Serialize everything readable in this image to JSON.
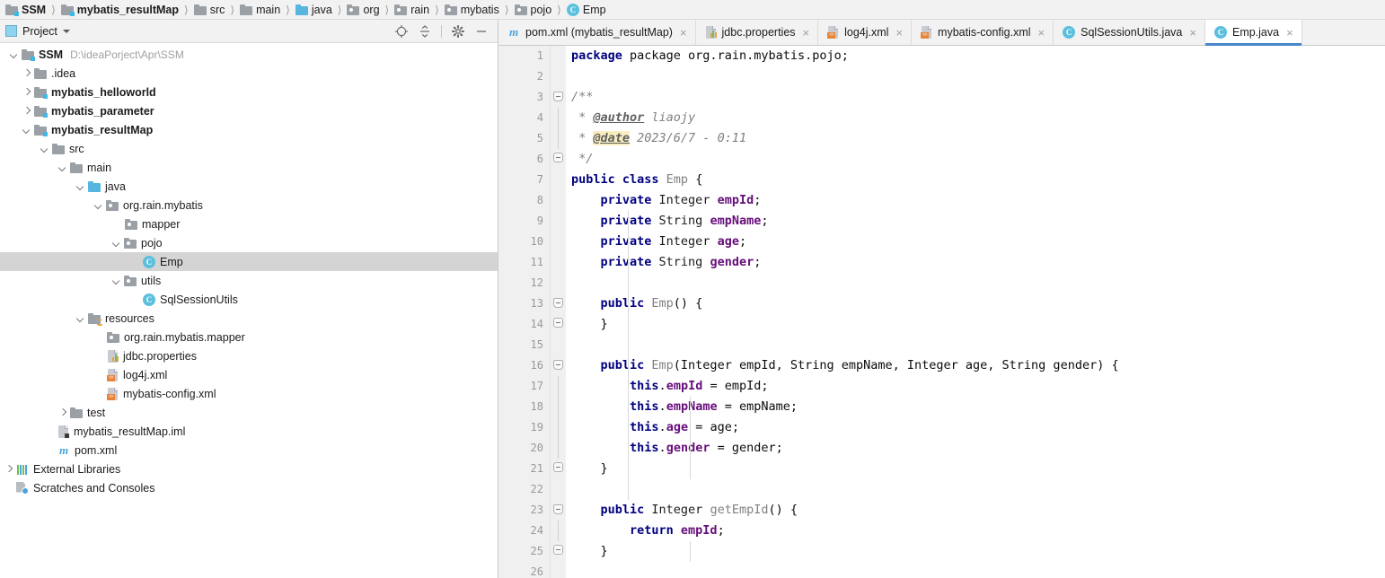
{
  "breadcrumb": [
    {
      "label": "SSM",
      "icon": "module-icon",
      "bold": true
    },
    {
      "label": "mybatis_resultMap",
      "icon": "module-icon",
      "bold": true
    },
    {
      "label": "src",
      "icon": "folder-icon",
      "bold": false
    },
    {
      "label": "main",
      "icon": "folder-icon",
      "bold": false
    },
    {
      "label": "java",
      "icon": "source-folder-icon",
      "bold": false
    },
    {
      "label": "org",
      "icon": "package-icon",
      "bold": false
    },
    {
      "label": "rain",
      "icon": "package-icon",
      "bold": false
    },
    {
      "label": "mybatis",
      "icon": "package-icon",
      "bold": false
    },
    {
      "label": "pojo",
      "icon": "package-icon",
      "bold": false
    },
    {
      "label": "Emp",
      "icon": "class-icon",
      "bold": false
    }
  ],
  "project_panel": {
    "title": "Project",
    "tools": [
      {
        "name": "locate-icon"
      },
      {
        "name": "collapse-all-icon"
      },
      {
        "name": "settings-gear-icon"
      },
      {
        "name": "hide-panel-icon"
      }
    ],
    "tree": [
      {
        "label": "SSM",
        "path": "D:\\ideaPorject\\Apr\\SSM",
        "icon": "module-icon",
        "arrow": "down",
        "indent": 0,
        "bold": true,
        "selected": false
      },
      {
        "label": ".idea",
        "path": "",
        "icon": "folder-icon",
        "arrow": "right",
        "indent": 1,
        "bold": false,
        "selected": false
      },
      {
        "label": "mybatis_helloworld",
        "path": "",
        "icon": "module-icon",
        "arrow": "right",
        "indent": 1,
        "bold": true,
        "selected": false
      },
      {
        "label": "mybatis_parameter",
        "path": "",
        "icon": "module-icon",
        "arrow": "right",
        "indent": 1,
        "bold": true,
        "selected": false
      },
      {
        "label": "mybatis_resultMap",
        "path": "",
        "icon": "module-icon",
        "arrow": "down",
        "indent": 1,
        "bold": true,
        "selected": false
      },
      {
        "label": "src",
        "path": "",
        "icon": "folder-icon",
        "arrow": "down",
        "indent": 2,
        "bold": false,
        "selected": false
      },
      {
        "label": "main",
        "path": "",
        "icon": "folder-icon",
        "arrow": "down",
        "indent": 3,
        "bold": false,
        "selected": false
      },
      {
        "label": "java",
        "path": "",
        "icon": "source-folder-icon",
        "arrow": "down",
        "indent": 4,
        "bold": false,
        "selected": false
      },
      {
        "label": "org.rain.mybatis",
        "path": "",
        "icon": "package-icon",
        "arrow": "down",
        "indent": 5,
        "bold": false,
        "selected": false
      },
      {
        "label": "mapper",
        "path": "",
        "icon": "package-icon",
        "arrow": "none",
        "indent": 6,
        "bold": false,
        "selected": false
      },
      {
        "label": "pojo",
        "path": "",
        "icon": "package-icon",
        "arrow": "down",
        "indent": 6,
        "bold": false,
        "selected": false
      },
      {
        "label": "Emp",
        "path": "",
        "icon": "class-icon",
        "arrow": "none",
        "indent": 7,
        "bold": false,
        "selected": true
      },
      {
        "label": "utils",
        "path": "",
        "icon": "package-icon",
        "arrow": "down",
        "indent": 6,
        "bold": false,
        "selected": false
      },
      {
        "label": "SqlSessionUtils",
        "path": "",
        "icon": "class-icon",
        "arrow": "none",
        "indent": 7,
        "bold": false,
        "selected": false
      },
      {
        "label": "resources",
        "path": "",
        "icon": "resources-folder-icon",
        "arrow": "down",
        "indent": 4,
        "bold": false,
        "selected": false
      },
      {
        "label": "org.rain.mybatis.mapper",
        "path": "",
        "icon": "package-icon",
        "arrow": "none",
        "indent": 5,
        "bold": false,
        "selected": false
      },
      {
        "label": "jdbc.properties",
        "path": "",
        "icon": "properties-file-icon",
        "arrow": "none",
        "indent": 5,
        "bold": false,
        "selected": false
      },
      {
        "label": "log4j.xml",
        "path": "",
        "icon": "xml-file-icon",
        "arrow": "none",
        "indent": 5,
        "bold": false,
        "selected": false
      },
      {
        "label": "mybatis-config.xml",
        "path": "",
        "icon": "xml-file-icon",
        "arrow": "none",
        "indent": 5,
        "bold": false,
        "selected": false
      },
      {
        "label": "test",
        "path": "",
        "icon": "folder-icon",
        "arrow": "right",
        "indent": 3,
        "bold": false,
        "selected": false
      },
      {
        "label": "mybatis_resultMap.iml",
        "path": "",
        "icon": "iml-file-icon",
        "arrow": "none",
        "indent": 3,
        "bold": false,
        "selected": false
      },
      {
        "label": "pom.xml",
        "path": "",
        "icon": "maven-icon",
        "arrow": "none",
        "indent": 3,
        "bold": false,
        "selected": false
      },
      {
        "label": "External Libraries",
        "path": "",
        "icon": "libraries-icon",
        "arrow": "right",
        "indent": 0,
        "bold": false,
        "selected": false
      },
      {
        "label": "Scratches and Consoles",
        "path": "",
        "icon": "scratches-icon",
        "arrow": "none",
        "indent": 0,
        "bold": false,
        "selected": false
      }
    ]
  },
  "editor": {
    "tabs": [
      {
        "label": "pom.xml (mybatis_resultMap)",
        "icon": "maven-icon",
        "active": false
      },
      {
        "label": "jdbc.properties",
        "icon": "properties-file-icon",
        "active": false
      },
      {
        "label": "log4j.xml",
        "icon": "xml-file-icon",
        "active": false
      },
      {
        "label": "mybatis-config.xml",
        "icon": "xml-file-icon",
        "active": false
      },
      {
        "label": "SqlSessionUtils.java",
        "icon": "class-icon",
        "active": false
      },
      {
        "label": "Emp.java",
        "icon": "class-icon",
        "active": true
      }
    ],
    "close_glyph": "×",
    "gutter_marker": "@",
    "line_numbers": [
      1,
      2,
      3,
      4,
      5,
      6,
      7,
      8,
      9,
      10,
      11,
      12,
      13,
      14,
      15,
      16,
      17,
      18,
      19,
      20,
      21,
      22,
      23,
      24,
      25,
      26
    ],
    "markers": {
      "13": "@",
      "16": "@"
    },
    "code": {
      "l1": "package org.rain.mybatis.pojo;",
      "l3": "/**",
      "l4_star": " * ",
      "l4_tag": "@author",
      "l4_text": " liaojy",
      "l5_star": " * ",
      "l5_tag": "@date",
      "l5_text": " 2023/6/7 - 0:11",
      "l6": " */",
      "l7_kw": "public class ",
      "l7_name": "Emp",
      "l7_tail": " {",
      "l8_kw": "    private ",
      "l8_type": "Integer ",
      "l8_fld": "empId",
      "l8_tail": ";",
      "l9_kw": "    private ",
      "l9_type": "String ",
      "l9_fld": "empName",
      "l9_tail": ";",
      "l10_kw": "    private ",
      "l10_type": "Integer ",
      "l10_fld": "age",
      "l10_tail": ";",
      "l11_kw": "    private ",
      "l11_type": "String ",
      "l11_fld": "gender",
      "l11_tail": ";",
      "l13_kw": "    public ",
      "l13_name": "Emp",
      "l13_tail": "() {",
      "l14": "    }",
      "l16_kw": "    public ",
      "l16_name": "Emp",
      "l16_tail": "(Integer empId, String empName, Integer age, String gender) {",
      "l17_kw": "        this",
      "l17_dot": ".",
      "l17_fld": "empId",
      "l17_tail": " = empId;",
      "l18_kw": "        this",
      "l18_dot": ".",
      "l18_fld": "empName",
      "l18_tail": " = empName;",
      "l19_kw": "        this",
      "l19_dot": ".",
      "l19_fld": "age",
      "l19_tail": " = age;",
      "l20_kw": "        this",
      "l20_dot": ".",
      "l20_fld": "gender",
      "l20_tail": " = gender;",
      "l21": "    }",
      "l23_kw": "    public ",
      "l23_type": "Integer ",
      "l23_name": "getEmpId",
      "l23_tail": "() {",
      "l24_kw": "        return ",
      "l24_fld": "empId",
      "l24_tail": ";",
      "l25": "    }"
    }
  },
  "colors": {
    "accent": "#4a86c8",
    "keyword": "#000080",
    "field": "#660e7a",
    "comment": "#808080",
    "selection": "#d4d4d4",
    "doc_tag_highlight": "#faeec0"
  }
}
